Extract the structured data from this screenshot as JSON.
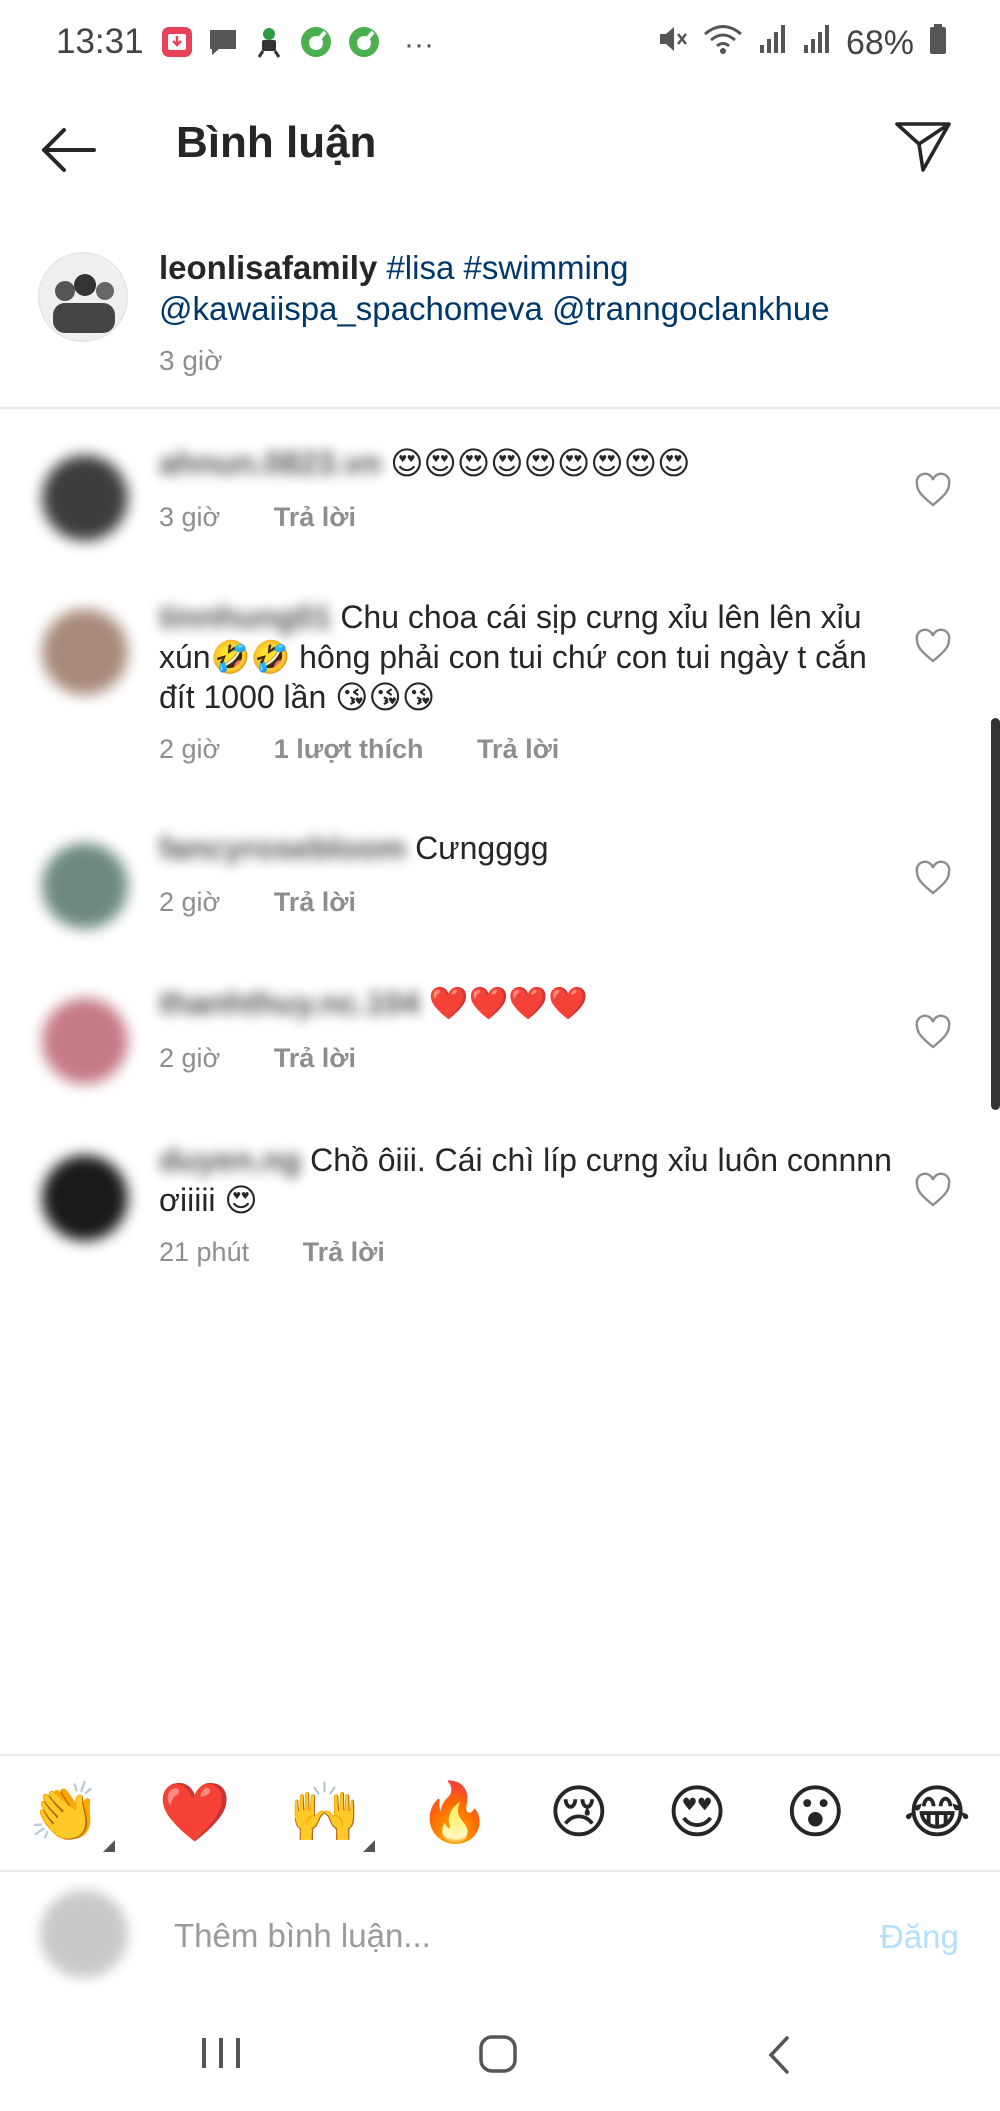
{
  "status_bar": {
    "time": "13:31",
    "more": "···",
    "battery": "68%",
    "icons": [
      "download-app-icon",
      "message-icon",
      "runner-app-icon",
      "green-app-icon",
      "green-app-icon",
      "mute-icon",
      "wifi-icon",
      "signal-icon",
      "battery-icon"
    ]
  },
  "header": {
    "title": "Bình luận",
    "back_icon": "arrow-left-icon",
    "share_icon": "send-icon"
  },
  "caption": {
    "username": "leonlisafamily",
    "tags": "#lisa #swimming",
    "mentions": "@kawaiispa_spachomeva @tranngoclankhue",
    "time": "3 giờ"
  },
  "comments": [
    {
      "username": "ahnun.0823.vn",
      "text": "😍😍😍😍😍😍😍😍😍",
      "time": "3 giờ",
      "likes": "",
      "reply": "Trả lời"
    },
    {
      "username": "tinnhung01",
      "text": "Chu choa cái sịp cưng xỉu lên lên xỉu xún🤣🤣 hông phải con tui chứ con tui ngày t cắn đít 1000 lần 😘😘😘",
      "time": "2 giờ",
      "likes": "1 lượt thích",
      "reply": "Trả lời"
    },
    {
      "username": "fancyrosebloom",
      "text": "Cưngggg",
      "time": "2 giờ",
      "likes": "",
      "reply": "Trả lời"
    },
    {
      "username": "thanhthuy.nc.104",
      "text": "❤️❤️❤️❤️",
      "time": "2 giờ",
      "likes": "",
      "reply": "Trả lời"
    },
    {
      "username": "duyen.ng",
      "text": "Chồ ôiii. Cái chì líp cưng xỉu luôn connnn ơiiiii 😍",
      "time": "21 phút",
      "likes": "",
      "reply": "Trả lời"
    }
  ],
  "reactions": [
    "👏",
    "❤️",
    "🙌",
    "🔥",
    "😢",
    "😍",
    "😮",
    "😂"
  ],
  "input": {
    "placeholder": "Thêm bình luận...",
    "post_label": "Đăng"
  },
  "colors": {
    "link": "#00376b",
    "meta": "#8e8e8e",
    "post_disabled": "#b2dffc",
    "text": "#262626"
  }
}
